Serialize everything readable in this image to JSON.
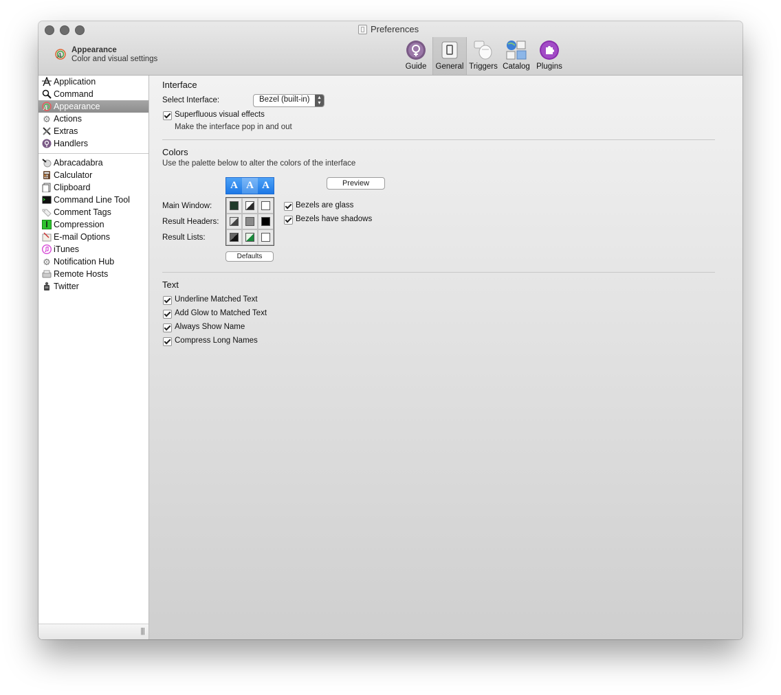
{
  "window": {
    "title": "Preferences"
  },
  "pane": {
    "title": "Appearance",
    "subtitle": "Color and visual settings"
  },
  "toolbar": [
    {
      "label": "Guide",
      "icon": "guide-icon"
    },
    {
      "label": "General",
      "icon": "general-icon",
      "selected": true
    },
    {
      "label": "Triggers",
      "icon": "triggers-icon"
    },
    {
      "label": "Catalog",
      "icon": "catalog-icon"
    },
    {
      "label": "Plugins",
      "icon": "plugins-icon"
    }
  ],
  "sidebar": {
    "group1": [
      {
        "label": "Application",
        "icon": "application-icon"
      },
      {
        "label": "Command",
        "icon": "command-icon"
      },
      {
        "label": "Appearance",
        "icon": "appearance-icon",
        "selected": true
      },
      {
        "label": "Actions",
        "icon": "gear-icon"
      },
      {
        "label": "Extras",
        "icon": "extras-icon"
      },
      {
        "label": "Handlers",
        "icon": "handlers-icon"
      }
    ],
    "group2": [
      {
        "label": "Abracadabra",
        "icon": "abracadabra-icon"
      },
      {
        "label": "Calculator",
        "icon": "calculator-icon"
      },
      {
        "label": "Clipboard",
        "icon": "clipboard-icon"
      },
      {
        "label": "Command Line Tool",
        "icon": "terminal-icon"
      },
      {
        "label": "Comment Tags",
        "icon": "tag-icon"
      },
      {
        "label": "Compression",
        "icon": "compression-icon"
      },
      {
        "label": "E-mail Options",
        "icon": "email-icon"
      },
      {
        "label": "iTunes",
        "icon": "itunes-icon"
      },
      {
        "label": "Notification Hub",
        "icon": "gear-icon"
      },
      {
        "label": "Remote Hosts",
        "icon": "remote-hosts-icon"
      },
      {
        "label": "Twitter",
        "icon": "twitter-icon"
      }
    ],
    "resize_grip": "|||"
  },
  "interface": {
    "title": "Interface",
    "select_label": "Select Interface:",
    "select_value": "Bezel (built-in)",
    "effects_label": "Superfluous visual effects",
    "effects_checked": true,
    "effects_hint": "Make the interface pop in and out"
  },
  "colors": {
    "title": "Colors",
    "description": "Use the palette below to alter the colors of the interface",
    "preview_label": "Preview",
    "defaults_label": "Defaults",
    "palette_header": [
      "A",
      "A",
      "A"
    ],
    "rows": [
      {
        "label": "Main Window:",
        "swatches": [
          "#1f3a2a",
          "#2a2a2a",
          "#ffffff"
        ]
      },
      {
        "label": "Result Headers:",
        "swatches": [
          "#444444",
          "#8a8a8a",
          "#000000"
        ]
      },
      {
        "label": "Result Lists:",
        "swatches": [
          "#111111",
          "#1a8a3c",
          "#ffffff"
        ]
      }
    ],
    "options": [
      {
        "label": "Bezels are glass",
        "checked": true
      },
      {
        "label": "Bezels have shadows",
        "checked": true
      }
    ]
  },
  "text": {
    "title": "Text",
    "options": [
      {
        "label": "Underline Matched Text",
        "checked": true
      },
      {
        "label": "Add Glow to Matched Text",
        "checked": true
      },
      {
        "label": "Always Show Name",
        "checked": true
      },
      {
        "label": "Compress Long Names",
        "checked": true
      }
    ]
  }
}
